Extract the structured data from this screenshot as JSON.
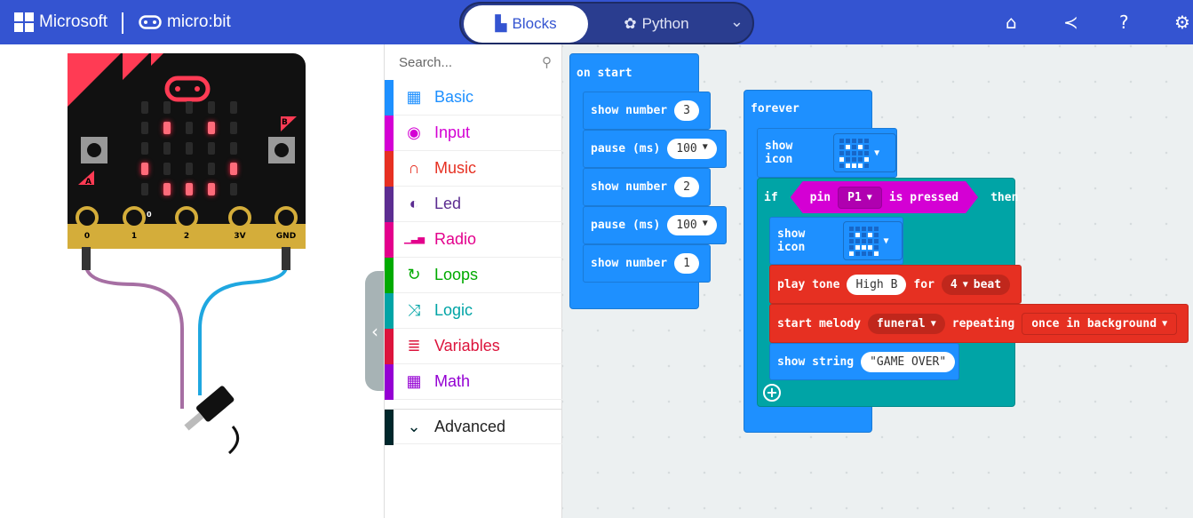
{
  "header": {
    "microsoft": "Microsoft",
    "microbit": "micro:bit",
    "tabs": [
      {
        "label": "Blocks",
        "icon": "puzzle-icon",
        "active": true
      },
      {
        "label": "Python",
        "icon": "python-icon",
        "active": false
      }
    ],
    "icons": [
      "home-icon",
      "share-icon",
      "help-icon",
      "settings-icon"
    ],
    "color": "#3454d1"
  },
  "simulator": {
    "pins": [
      "0",
      "1",
      "2",
      "3V",
      "GND"
    ],
    "buttons": [
      "A",
      "B"
    ],
    "pin_value": "0",
    "display": [
      [
        0,
        0,
        0,
        0,
        0
      ],
      [
        0,
        1,
        0,
        1,
        0
      ],
      [
        0,
        0,
        0,
        0,
        0
      ],
      [
        1,
        0,
        0,
        0,
        1
      ],
      [
        0,
        1,
        1,
        1,
        0
      ]
    ]
  },
  "toolbox": {
    "search_placeholder": "Search...",
    "categories": [
      {
        "label": "Basic",
        "color": "#1e90ff",
        "icon": "grid-icon"
      },
      {
        "label": "Input",
        "color": "#d400d4",
        "icon": "target-icon"
      },
      {
        "label": "Music",
        "color": "#e63022",
        "icon": "headphones-icon"
      },
      {
        "label": "Led",
        "color": "#5c2d91",
        "icon": "toggle-icon"
      },
      {
        "label": "Radio",
        "color": "#e3008c",
        "icon": "signal-icon"
      },
      {
        "label": "Loops",
        "color": "#00aa00",
        "icon": "refresh-icon"
      },
      {
        "label": "Logic",
        "color": "#00a4a6",
        "icon": "shuffle-icon"
      },
      {
        "label": "Variables",
        "color": "#dc143c",
        "icon": "list-icon"
      },
      {
        "label": "Math",
        "color": "#9400d3",
        "icon": "calculator-icon"
      }
    ],
    "advanced": {
      "label": "Advanced",
      "color": "#00272b"
    }
  },
  "workspace": {
    "on_start": {
      "label": "on start",
      "statements": [
        {
          "label": "show number",
          "value": "3"
        },
        {
          "label": "pause (ms)",
          "value": "100"
        },
        {
          "label": "show number",
          "value": "2"
        },
        {
          "label": "pause (ms)",
          "value": "100"
        },
        {
          "label": "show number",
          "value": "1"
        }
      ]
    },
    "forever": {
      "label": "forever",
      "show_icon_1": {
        "label": "show icon",
        "icon": [
          [
            0,
            0,
            0,
            0,
            0
          ],
          [
            0,
            1,
            0,
            1,
            0
          ],
          [
            0,
            0,
            0,
            0,
            0
          ],
          [
            1,
            0,
            0,
            0,
            1
          ],
          [
            0,
            1,
            1,
            1,
            0
          ]
        ]
      },
      "if": {
        "if": "if",
        "pin": "pin",
        "pin_value": "P1",
        "is_pressed": "is pressed",
        "then": "then"
      },
      "show_icon_2": {
        "label": "show icon",
        "icon": [
          [
            0,
            0,
            0,
            0,
            0
          ],
          [
            0,
            1,
            0,
            1,
            0
          ],
          [
            0,
            0,
            0,
            0,
            0
          ],
          [
            0,
            1,
            1,
            1,
            0
          ],
          [
            1,
            0,
            0,
            0,
            1
          ]
        ]
      },
      "play_tone": {
        "label": "play tone",
        "note": "High B",
        "for": "for",
        "beats": "4",
        "beat": "beat"
      },
      "melody": {
        "label": "start melody",
        "melody": "funeral",
        "repeating": "repeating",
        "mode": "once in background"
      },
      "show_string": {
        "label": "show string",
        "value": "\"GAME OVER\""
      }
    }
  }
}
